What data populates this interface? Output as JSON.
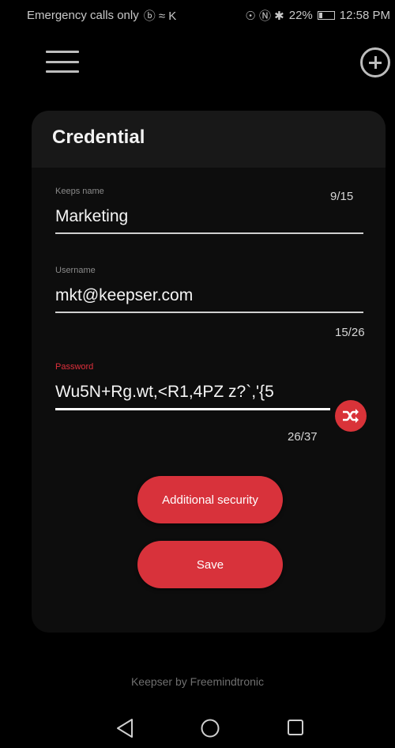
{
  "status_bar": {
    "carrier_text": "Emergency calls only",
    "extra_icons": "ⓑ ≈ K",
    "right_icons": "☉ Ⓝ ✱",
    "battery_percent": "22%",
    "time": "12:58 PM"
  },
  "card": {
    "title": "Credential"
  },
  "fields": {
    "keeps_name": {
      "label": "Keeps name",
      "value": "Marketing",
      "counter": "9/15"
    },
    "username": {
      "label": "Username",
      "value": "mkt@keepser.com",
      "counter": "15/26"
    },
    "password": {
      "label": "Password",
      "value": "Wu5N+Rg.wt,<R1,4PZ z?`,'{5",
      "counter": "26/37"
    }
  },
  "buttons": {
    "additional_security": "Additional security",
    "save": "Save"
  },
  "footer": {
    "text": "Keepser by Freemindtronic"
  },
  "colors": {
    "accent": "#d8323b",
    "background": "#000000",
    "card": "#0d0d0d",
    "card_header": "#181818"
  },
  "icons": {
    "menu": "hamburger-icon",
    "add": "plus-circle-icon",
    "shuffle": "shuffle-icon",
    "nav_back": "triangle-back-icon",
    "nav_home": "circle-home-icon",
    "nav_recent": "square-recent-icon"
  }
}
